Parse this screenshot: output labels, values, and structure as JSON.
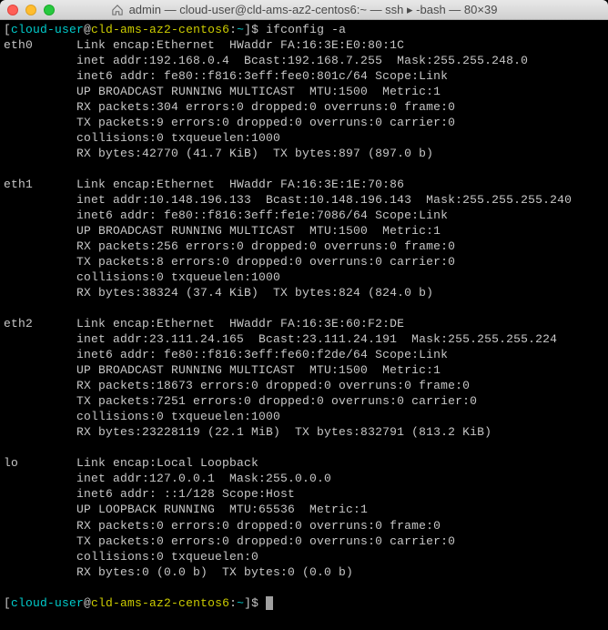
{
  "titlebar": {
    "title": "admin — cloud-user@cld-ams-az2-centos6:~ — ssh ▸ -bash — 80×39"
  },
  "prompt": {
    "user": "cloud-user",
    "at": "@",
    "host": "cld-ams-az2-centos6",
    "colon": ":",
    "path": "~",
    "end": "]$ "
  },
  "command": "ifconfig -a",
  "interfaces": [
    {
      "name": "eth0",
      "lines": [
        "Link encap:Ethernet  HWaddr FA:16:3E:E0:80:1C  ",
        "inet addr:192.168.0.4  Bcast:192.168.7.255  Mask:255.255.248.0",
        "inet6 addr: fe80::f816:3eff:fee0:801c/64 Scope:Link",
        "UP BROADCAST RUNNING MULTICAST  MTU:1500  Metric:1",
        "RX packets:304 errors:0 dropped:0 overruns:0 frame:0",
        "TX packets:9 errors:0 dropped:0 overruns:0 carrier:0",
        "collisions:0 txqueuelen:1000 ",
        "RX bytes:42770 (41.7 KiB)  TX bytes:897 (897.0 b)"
      ]
    },
    {
      "name": "eth1",
      "lines": [
        "Link encap:Ethernet  HWaddr FA:16:3E:1E:70:86  ",
        "inet addr:10.148.196.133  Bcast:10.148.196.143  Mask:255.255.255.240",
        "inet6 addr: fe80::f816:3eff:fe1e:7086/64 Scope:Link",
        "UP BROADCAST RUNNING MULTICAST  MTU:1500  Metric:1",
        "RX packets:256 errors:0 dropped:0 overruns:0 frame:0",
        "TX packets:8 errors:0 dropped:0 overruns:0 carrier:0",
        "collisions:0 txqueuelen:1000 ",
        "RX bytes:38324 (37.4 KiB)  TX bytes:824 (824.0 b)"
      ]
    },
    {
      "name": "eth2",
      "lines": [
        "Link encap:Ethernet  HWaddr FA:16:3E:60:F2:DE  ",
        "inet addr:23.111.24.165  Bcast:23.111.24.191  Mask:255.255.255.224",
        "inet6 addr: fe80::f816:3eff:fe60:f2de/64 Scope:Link",
        "UP BROADCAST RUNNING MULTICAST  MTU:1500  Metric:1",
        "RX packets:18673 errors:0 dropped:0 overruns:0 frame:0",
        "TX packets:7251 errors:0 dropped:0 overruns:0 carrier:0",
        "collisions:0 txqueuelen:1000 ",
        "RX bytes:23228119 (22.1 MiB)  TX bytes:832791 (813.2 KiB)"
      ]
    },
    {
      "name": "lo",
      "lines": [
        "Link encap:Local Loopback  ",
        "inet addr:127.0.0.1  Mask:255.0.0.0",
        "inet6 addr: ::1/128 Scope:Host",
        "UP LOOPBACK RUNNING  MTU:65536  Metric:1",
        "RX packets:0 errors:0 dropped:0 overruns:0 frame:0",
        "TX packets:0 errors:0 dropped:0 overruns:0 carrier:0",
        "collisions:0 txqueuelen:0 ",
        "RX bytes:0 (0.0 b)  TX bytes:0 (0.0 b)"
      ]
    }
  ]
}
